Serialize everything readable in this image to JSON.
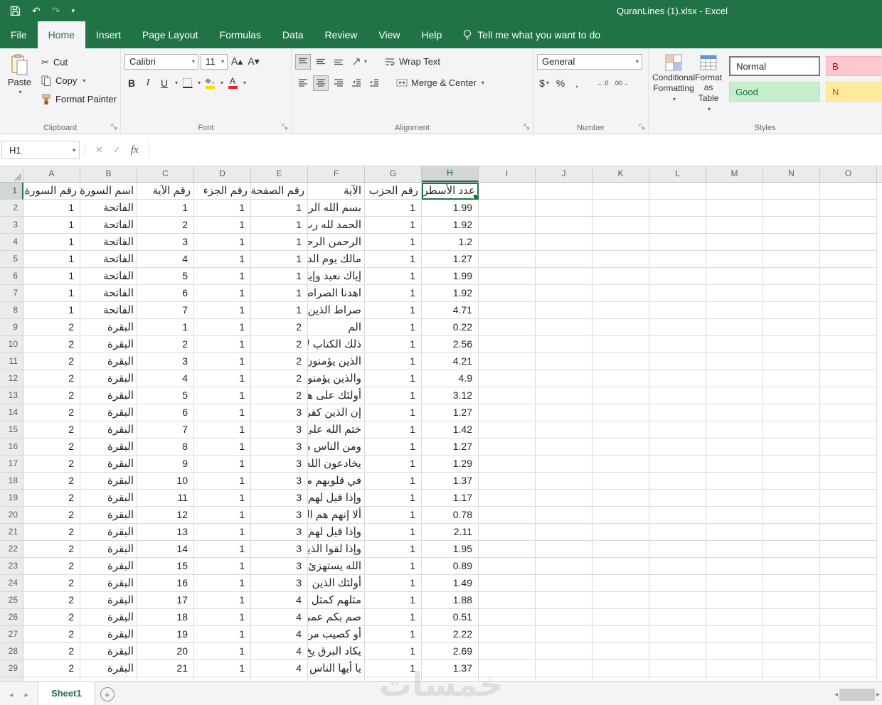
{
  "colors": {
    "theme_green": "#217346",
    "selection_border": "#217346",
    "good_bg": "#c6efce",
    "good_text": "#1d6b35",
    "bad_bg": "#ffc7ce",
    "bad_text": "#9c0006",
    "neutral_bg": "#ffeb9c",
    "neutral_text": "#9c6500",
    "fill_accent": "#ffd800",
    "font_color_accent": "#e8261f"
  },
  "icons": {
    "dropdown": "▾",
    "undo": "↶",
    "redo": "↷",
    "cut": "✂",
    "cancel": "✕",
    "check": "✓",
    "nav_left": "◂",
    "nav_right": "▸",
    "new_sheet": "+",
    "dollar": "$",
    "percent": "%",
    "comma": ",",
    "increase_decimal": "←.0",
    "decrease_decimal": ".00→",
    "bold": "B",
    "italic": "I",
    "underline": "U",
    "font_grow": "A▴",
    "font_shrink": "A▾",
    "font_color_letter": "A",
    "name_box_separator": "⋮"
  },
  "titlebar": {
    "title": "QuranLines (1).xlsx - Excel"
  },
  "tabs": {
    "items": [
      "File",
      "Home",
      "Insert",
      "Page Layout",
      "Formulas",
      "Data",
      "Review",
      "View",
      "Help"
    ],
    "active": "Home",
    "tell_me": "Tell me what you want to do"
  },
  "ribbon": {
    "clipboard": {
      "label": "Clipboard",
      "paste": "Paste",
      "cut": "Cut",
      "copy": "Copy",
      "format_painter": "Format Painter"
    },
    "font": {
      "label": "Font",
      "family": "Calibri",
      "size": "11"
    },
    "alignment": {
      "label": "Alignment",
      "wrap_text": "Wrap Text",
      "merge_center": "Merge & Center"
    },
    "number": {
      "label": "Number",
      "format": "General"
    },
    "styles": {
      "label": "Styles",
      "conditional_line1": "Conditional",
      "conditional_line2": "Formatting",
      "format_table_line1": "Format as",
      "format_table_line2": "Table",
      "gallery": [
        {
          "label": "Normal",
          "type": "normal"
        },
        {
          "label": "Good",
          "type": "good"
        },
        {
          "label": "B",
          "type": "bad"
        },
        {
          "label": "N",
          "type": "neutral"
        }
      ]
    }
  },
  "formula_bar": {
    "name_box": "H1",
    "fx": "fx",
    "value": ""
  },
  "grid": {
    "columns": [
      "A",
      "B",
      "C",
      "D",
      "E",
      "F",
      "G",
      "H",
      "I",
      "J",
      "K",
      "L",
      "M",
      "N",
      "O"
    ],
    "selected_column": "H",
    "selected_cell": "H1",
    "header_row": [
      "رقم السورة",
      "اسم السورة",
      "رقم الآية",
      "رقم الجزء",
      "رقم الصفحة",
      "الآية",
      "رقم الحزب",
      "عدد الأسطر"
    ],
    "rows": [
      [
        "1",
        "الفاتحة",
        "1",
        "1",
        "1",
        "بسم الله الرح",
        "1",
        "1.99"
      ],
      [
        "1",
        "الفاتحة",
        "2",
        "1",
        "1",
        "الحمد لله رب",
        "1",
        "1.92"
      ],
      [
        "1",
        "الفاتحة",
        "3",
        "1",
        "1",
        "الرحمن الرحي",
        "1",
        "1.2"
      ],
      [
        "1",
        "الفاتحة",
        "4",
        "1",
        "1",
        "مالك يوم الدي",
        "1",
        "1.27"
      ],
      [
        "1",
        "الفاتحة",
        "5",
        "1",
        "1",
        "إياك نعبد وإيا",
        "1",
        "1.99"
      ],
      [
        "1",
        "الفاتحة",
        "6",
        "1",
        "1",
        "اهدنا الصراط",
        "1",
        "1.92"
      ],
      [
        "1",
        "الفاتحة",
        "7",
        "1",
        "1",
        "صراط الذين أ",
        "1",
        "4.71"
      ],
      [
        "2",
        "البقرة",
        "1",
        "1",
        "2",
        "الم",
        "1",
        "0.22"
      ],
      [
        "2",
        "البقرة",
        "2",
        "1",
        "2",
        "ذلك الكتاب لا",
        "1",
        "2.56"
      ],
      [
        "2",
        "البقرة",
        "3",
        "1",
        "2",
        "الذين يؤمنون",
        "1",
        "4.21"
      ],
      [
        "2",
        "البقرة",
        "4",
        "1",
        "2",
        "والذين يؤمنو",
        "1",
        "4.9"
      ],
      [
        "2",
        "البقرة",
        "5",
        "1",
        "2",
        "أولئك على هد",
        "1",
        "3.12"
      ],
      [
        "2",
        "البقرة",
        "6",
        "1",
        "3",
        "إن الذين كفرو",
        "1",
        "1.27"
      ],
      [
        "2",
        "البقرة",
        "7",
        "1",
        "3",
        "ختم الله على",
        "1",
        "1.42"
      ],
      [
        "2",
        "البقرة",
        "8",
        "1",
        "3",
        "ومن الناس مر",
        "1",
        "1.27"
      ],
      [
        "2",
        "البقرة",
        "9",
        "1",
        "3",
        "يخادعون الله",
        "1",
        "1.29"
      ],
      [
        "2",
        "البقرة",
        "10",
        "1",
        "3",
        "في قلوبهم مرض",
        "1",
        "1.37"
      ],
      [
        "2",
        "البقرة",
        "11",
        "1",
        "3",
        "وإذا قيل لهم ا",
        "1",
        "1.17"
      ],
      [
        "2",
        "البقرة",
        "12",
        "1",
        "3",
        "ألا إنهم هم الم",
        "1",
        "0.78"
      ],
      [
        "2",
        "البقرة",
        "13",
        "1",
        "3",
        "وإذا قيل لهم",
        "1",
        "2.11"
      ],
      [
        "2",
        "البقرة",
        "14",
        "1",
        "3",
        "وإذا لقوا الذين",
        "1",
        "1.95"
      ],
      [
        "2",
        "البقرة",
        "15",
        "1",
        "3",
        "الله يستهزئ ب",
        "1",
        "0.89"
      ],
      [
        "2",
        "البقرة",
        "16",
        "1",
        "3",
        "أولئك الذين ا",
        "1",
        "1.49"
      ],
      [
        "2",
        "البقرة",
        "17",
        "1",
        "4",
        "مثلهم كمثل ال",
        "1",
        "1.88"
      ],
      [
        "2",
        "البقرة",
        "18",
        "1",
        "4",
        "صم بكم عمي",
        "1",
        "0.51"
      ],
      [
        "2",
        "البقرة",
        "19",
        "1",
        "4",
        "أو كصيب من",
        "1",
        "2.22"
      ],
      [
        "2",
        "البقرة",
        "20",
        "1",
        "4",
        "يكاد البرق يخ",
        "1",
        "2.69"
      ],
      [
        "2",
        "البقرة",
        "21",
        "1",
        "4",
        "يا أيها الناس اع",
        "1",
        "1.37"
      ]
    ]
  },
  "sheet_bar": {
    "active_tab": "Sheet1"
  },
  "watermark": "خمسات"
}
